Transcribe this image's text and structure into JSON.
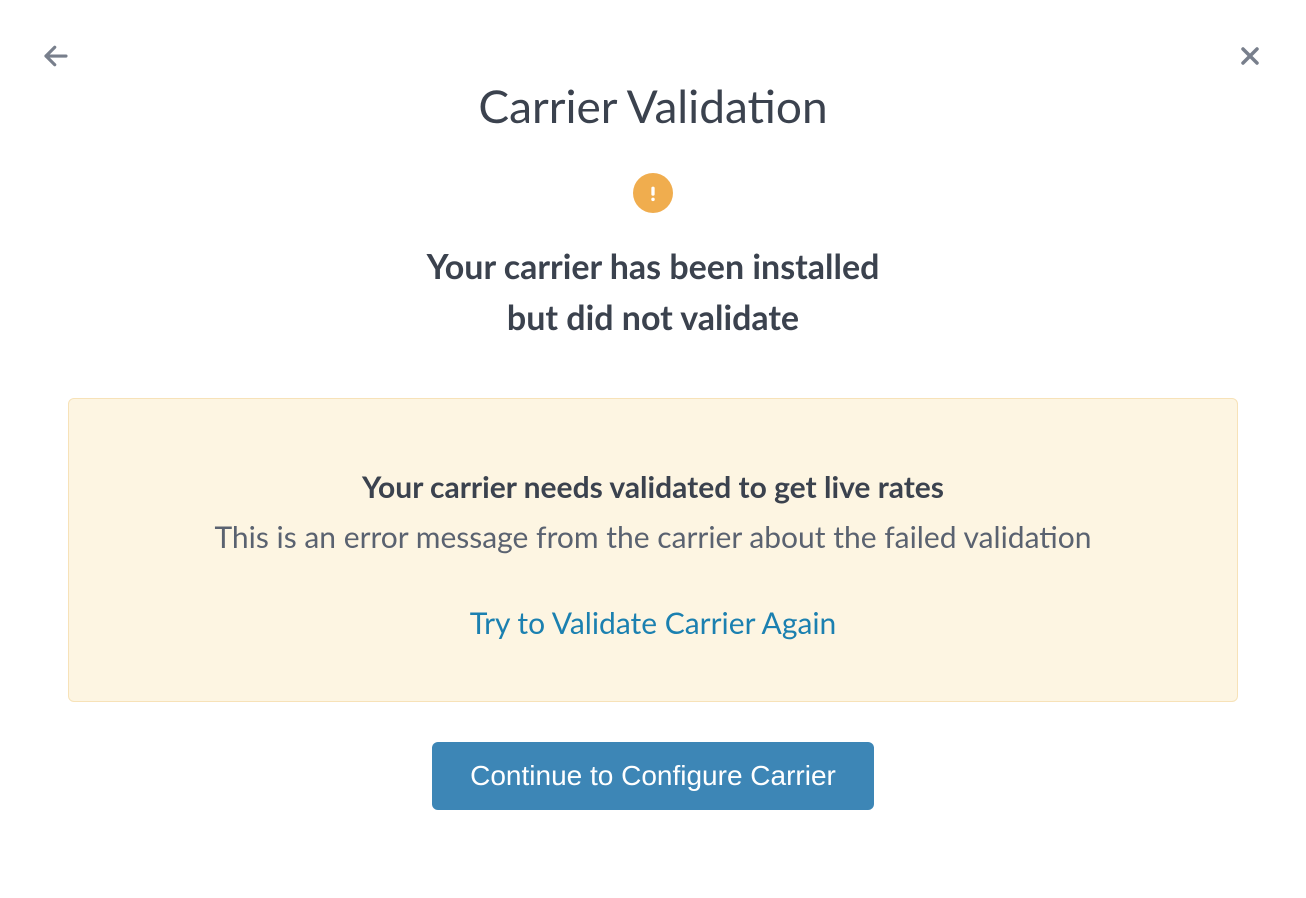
{
  "modal": {
    "title": "Carrier Validation",
    "subtitle_line1": "Your carrier has been installed",
    "subtitle_line2": "but did not validate"
  },
  "alert": {
    "heading": "Your carrier needs validated to get live rates",
    "message": "This is an error message from the carrier about the failed validation",
    "retry_label": "Try to Validate Carrier Again"
  },
  "actions": {
    "continue_label": "Continue to Configure Carrier"
  },
  "colors": {
    "title_text": "#3b424e",
    "body_text": "#5a6270",
    "icon_gray": "#787f8c",
    "warning_orange": "#f0ad4e",
    "alert_bg": "#fdf5e2",
    "alert_border": "#f7e2b8",
    "link_blue": "#1b80b0",
    "button_blue": "#3d86b6"
  }
}
